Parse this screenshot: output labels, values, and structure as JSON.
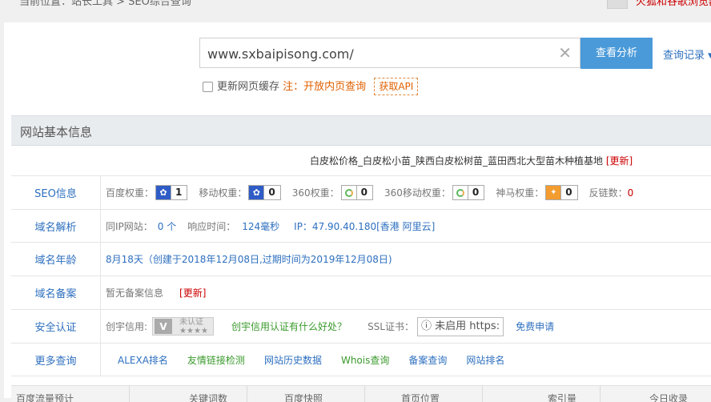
{
  "breadcrumb": "当前位置：站长工具 > SEO综合查询",
  "top_right_text": "火狐和谷歌浏览器",
  "search": {
    "value": "www.sxbaipisong.com/",
    "analyze_label": "查看分析",
    "history_label": "查询记录"
  },
  "options": {
    "update_cache": "更新网页缓存",
    "note": "注：开放内页查询",
    "get_api": "获取API"
  },
  "section_title": "网站基本信息",
  "site_title": "白皮松价格_白皮松小苗_陕西白皮松树苗_蓝田西北大型苗木种植基地",
  "update_label": "[更新]",
  "rows": {
    "seo": {
      "label": "SEO信息",
      "baidu": "百度权重：",
      "baidu_val": "1",
      "mobile": "移动权重：",
      "mobile_val": "0",
      "r360": "360权重：",
      "r360_val": "0",
      "r360m": "360移动权重：",
      "r360m_val": "0",
      "shenma": "神马权重：",
      "shenma_val": "0",
      "backlinks": "反链数：",
      "backlinks_val": "0"
    },
    "dns": {
      "label": "域名解析",
      "same_ip": "同IP网站：",
      "same_ip_val": "0 个",
      "resp": "响应时间：",
      "resp_val": "124毫秒",
      "ip": "IP：47.90.40.180[香港 阿里云]"
    },
    "age": {
      "label": "域名年龄",
      "text": "8月18天（创建于2018年12月08日,过期时间为2019年12月08日)"
    },
    "beian": {
      "label": "域名备案",
      "text": "暂无备案信息"
    },
    "security": {
      "label": "安全认证",
      "chuangyu": "创宇信用:",
      "cert_text": "未认证",
      "cert_stars": "★★★★",
      "question": "创宇信用认证有什么好处？",
      "ssl": "SSL证书：",
      "ssl_box": "ⓘ 未启用 https:",
      "free": "免费申请"
    },
    "more": {
      "label": "更多查询",
      "links": [
        "ALEXA排名",
        "友情链接检测",
        "网站历史数据",
        "Whois查询",
        "备案查询",
        "网站排名"
      ]
    }
  },
  "bottom_tabs": [
    "百度流量预计",
    "关键词数",
    "百度快照",
    "首页位置",
    "索引量",
    "今日收录"
  ],
  "colors": {
    "accent": "#4a9ad9",
    "link": "#2d6fbf",
    "warn": "#e06000",
    "red": "#cc0000"
  }
}
